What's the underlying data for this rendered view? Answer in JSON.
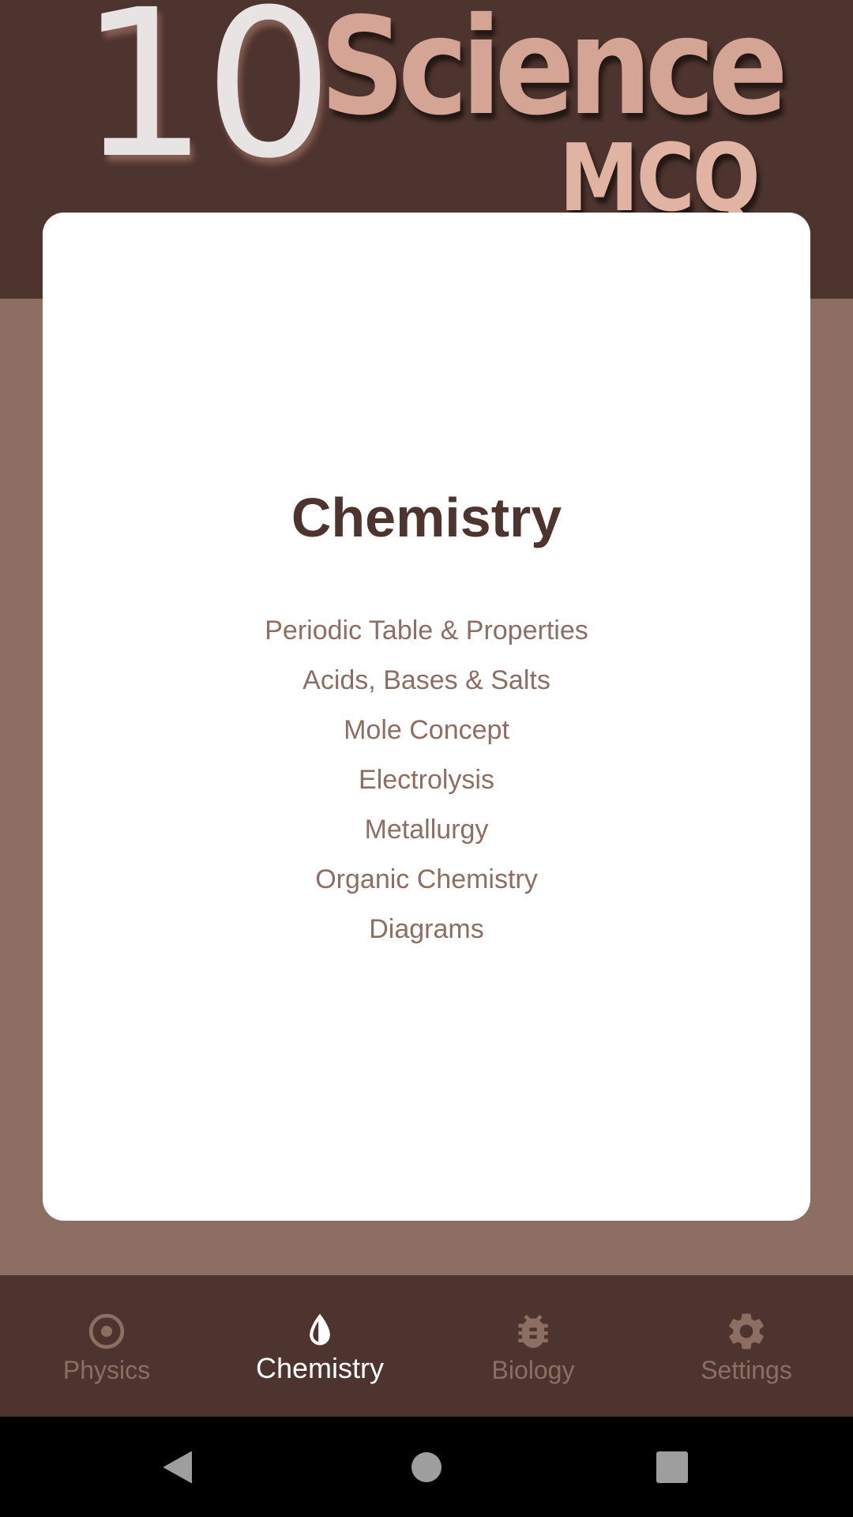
{
  "app": {
    "logo": {
      "number": "10",
      "subject": "Science",
      "tagline": "MCQ"
    }
  },
  "colors": {
    "primary_dark": "#4e342e",
    "primary": "#8d6e63",
    "logo_number": "#e8e4e4",
    "logo_subject": "#d4a595",
    "logo_tagline": "#e0b3a3",
    "nav_active": "#ffffff",
    "nav_inactive": "#8d6e63"
  },
  "card": {
    "title": "Chemistry",
    "topics": [
      "Periodic Table & Properties",
      "Acids, Bases & Salts",
      "Mole Concept",
      "Electrolysis",
      "Metallurgy",
      "Organic Chemistry",
      "Diagrams"
    ]
  },
  "bottom_nav": {
    "items": [
      {
        "label": "Physics",
        "icon": "radio-button-icon",
        "active": false
      },
      {
        "label": "Chemistry",
        "icon": "water-drop-icon",
        "active": true
      },
      {
        "label": "Biology",
        "icon": "bug-icon",
        "active": false
      },
      {
        "label": "Settings",
        "icon": "gear-icon",
        "active": false
      }
    ]
  },
  "system_nav": {
    "buttons": [
      "back",
      "home",
      "recents"
    ]
  }
}
